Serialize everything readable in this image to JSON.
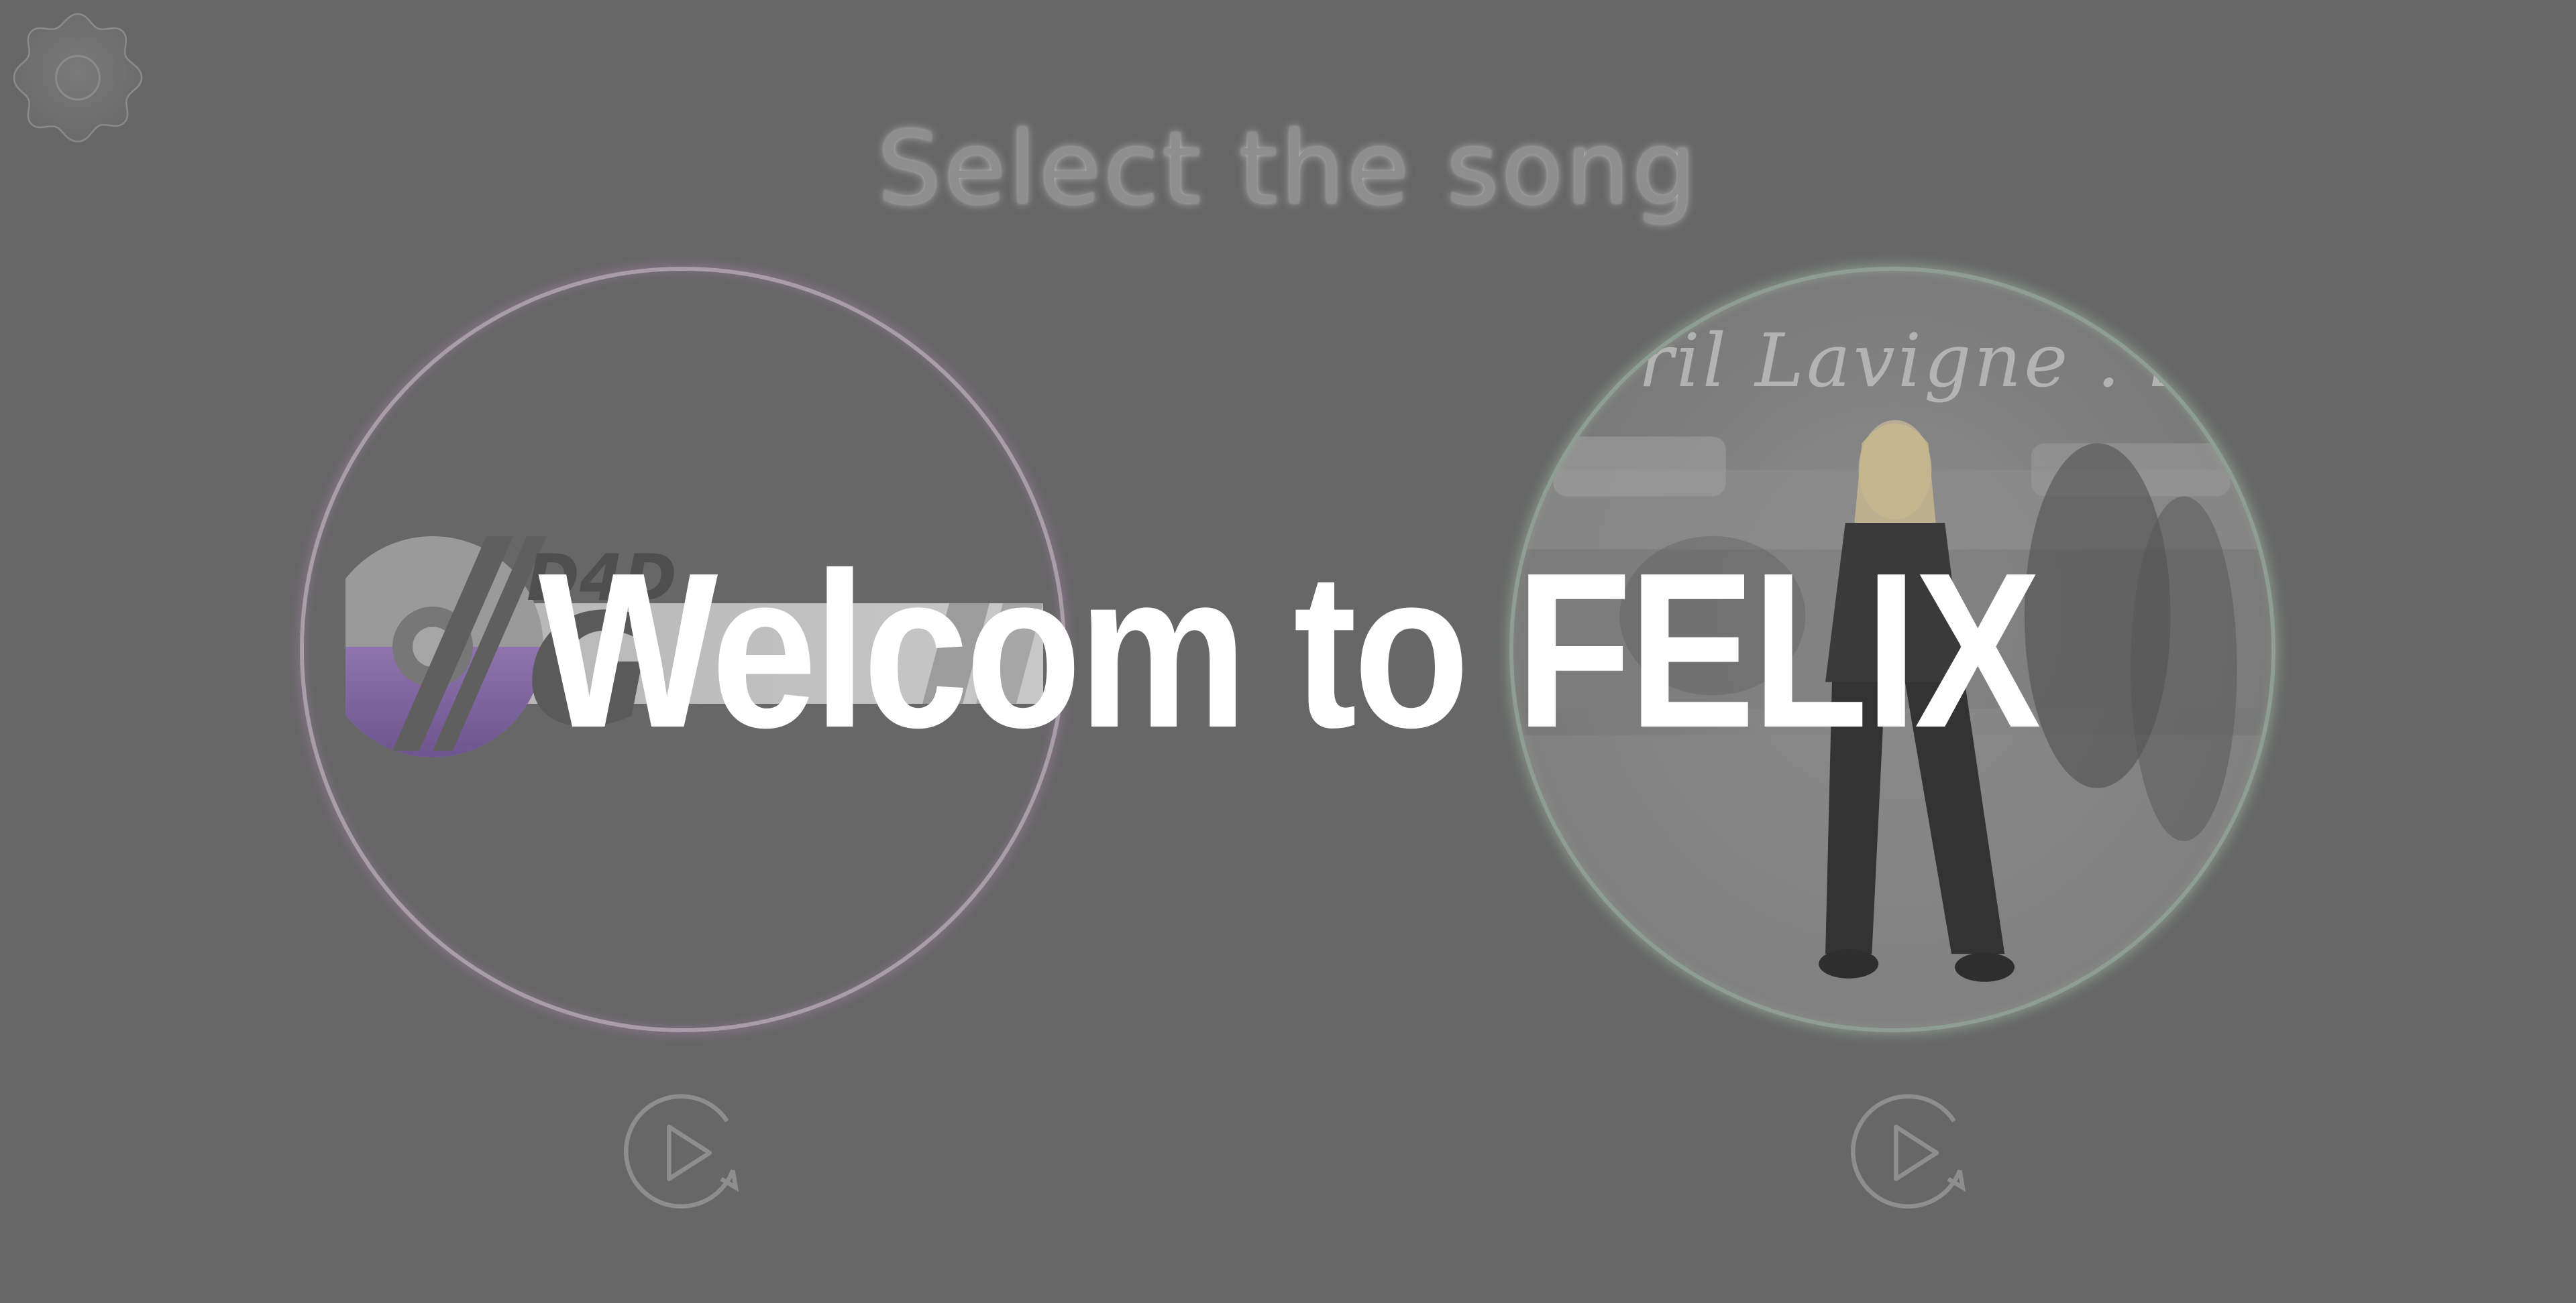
{
  "screen": {
    "heading": "Select the song",
    "overlay_title": "Welcom to FELIX"
  },
  "settings": {
    "icon": "gear-icon"
  },
  "songs": [
    {
      "position": "left",
      "cover_text": [
        "D4D",
        "G"
      ],
      "glow_color": "#d9a6e0",
      "replay_icon": "replay-icon"
    },
    {
      "position": "right",
      "cover_text": [
        "vril Lavigne . let"
      ],
      "glow_color": "#c8efd4",
      "replay_icon": "replay-icon"
    }
  ],
  "colors": {
    "background": "#676767",
    "overlay_text": "#ffffff",
    "heading_text": "#8e8e8e",
    "logo_purple": "#8a6fa8"
  }
}
